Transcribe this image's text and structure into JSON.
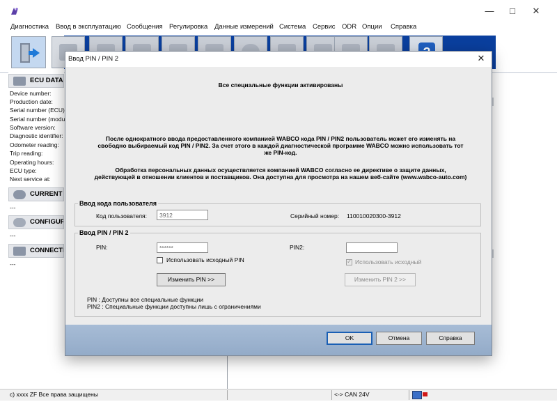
{
  "menu": [
    "Диагностика",
    "Ввод в эксплуатацию",
    "Сообщения",
    "Регулировка",
    "Данные измерений",
    "Система",
    "Сервис",
    "ODR",
    "Опции",
    "Справка"
  ],
  "left_panel": {
    "ecu_header": "ECU DATA",
    "ecu_rows": [
      "Device number:",
      "Production date:",
      "Serial number (ECU):",
      "Serial number (modul",
      "Software version:",
      "Diagnostic identifier:",
      "Odometer reading:",
      "Trip reading:",
      "Operating hours:",
      "ECU type:",
      "Next service at:"
    ],
    "current_header": "CURRENT M",
    "current_value": "---",
    "config_header": "CONFIGURA",
    "config_value": "---",
    "connected_header": "CONNECTEI",
    "connected_value": "---"
  },
  "status": {
    "copyright": "c) xxxx ZF Все права защищены",
    "can": "<-> CAN 24V"
  },
  "dialog": {
    "title": "Ввод PIN / PIN 2",
    "msg_activated": "Все специальные функции активированы",
    "msg_change_1": "После однократного ввода предоставленного компанией WABCO кода PIN / PIN2 пользователь может его изменять на",
    "msg_change_2": "свободно выбираемый код PIN / PIN2. За счет этого в каждой диагностической программе WABCO можно использовать тот",
    "msg_change_3": "же PIN-код.",
    "msg_privacy_1": "Обработка персональных данных осуществляется компанией WABCO согласно ее директиве о защите данных,",
    "msg_privacy_2": "действующей в отношении клиентов и поставщиков. Она доступна для просмотра на нашем веб-сайте (www.wabco-auto.com)",
    "user_group": {
      "title": "Ввод кода пользователя",
      "user_code_label": "Код пользователя:",
      "user_code_value": "3912",
      "serial_label": "Серийный номер:",
      "serial_value": "110010020300-3912"
    },
    "pin_group": {
      "title": "Ввод PIN / PIN 2",
      "pin_label": "PIN:",
      "pin_value": "******",
      "pin2_label": "PIN2:",
      "pin2_value": "",
      "use_original_pin": "Использовать исходный PIN",
      "use_original_pin_checked": false,
      "use_original_2": "Использовать исходный",
      "use_original_2_checked": true,
      "change_pin_button": "Изменить PIN >>",
      "change_pin2_button": "Изменить PIN 2 >>",
      "note_pin": "PIN   : Доступны все специальные функции",
      "note_pin2": "PIN2 : Специальные функции доступны лишь с ограничениями"
    },
    "ok": "OK",
    "cancel": "Отмена",
    "help": "Справка"
  }
}
